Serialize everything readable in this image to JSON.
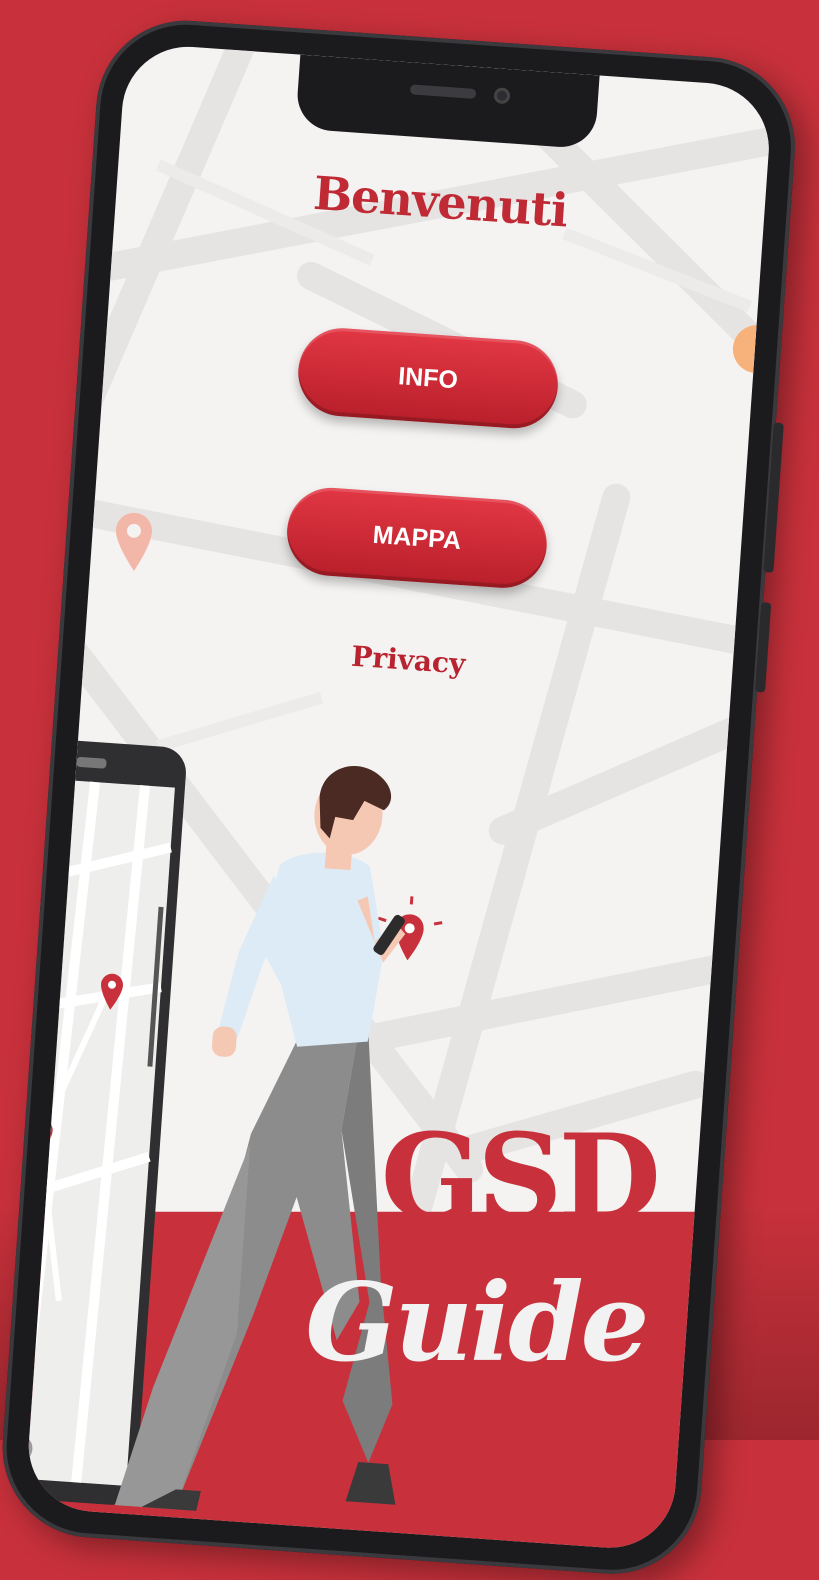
{
  "screen": {
    "welcome_title": "Benvenuti",
    "buttons": {
      "info_label": "INFO",
      "map_label": "MAPPA"
    },
    "privacy_link": "Privacy",
    "brand": {
      "line1": "GSD",
      "line2": "Guide"
    }
  },
  "colors": {
    "background": "#c8313b",
    "accent": "#c02a35",
    "screen_bg": "#f4f3f2"
  },
  "icons": [
    "map-pin-icon",
    "person-with-phone-illustration",
    "phone-map-illustration"
  ]
}
